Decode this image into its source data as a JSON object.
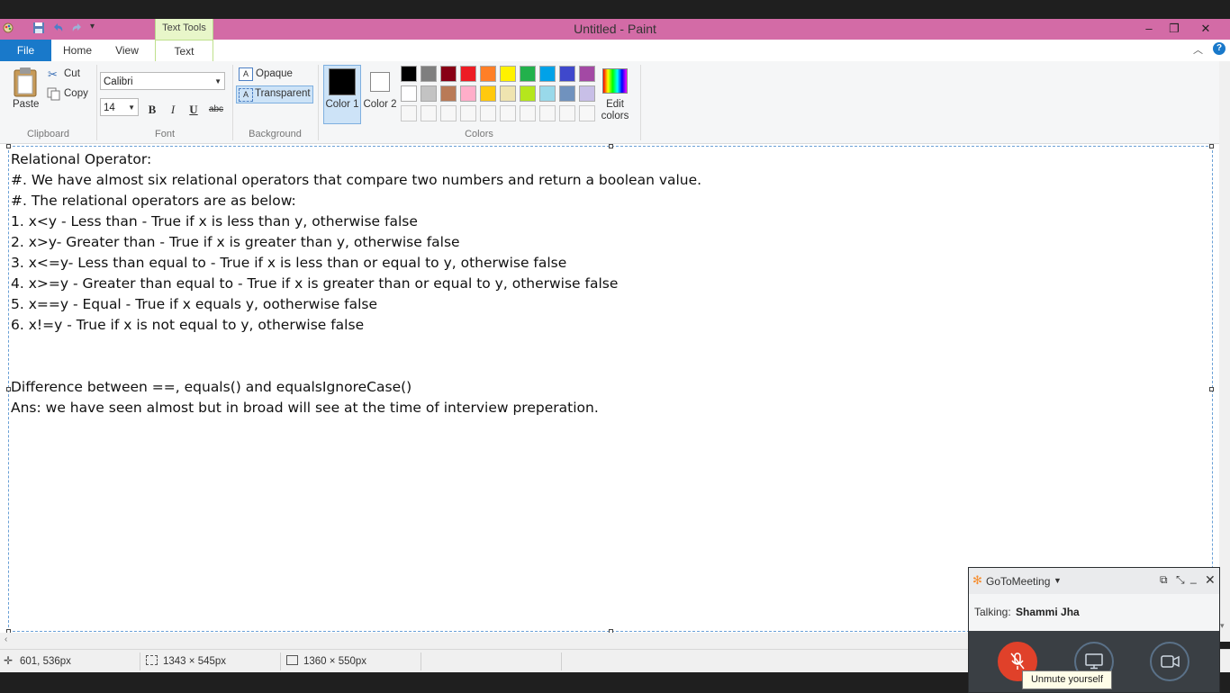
{
  "window": {
    "title": "Untitled - Paint",
    "contextual_tab": "Text Tools"
  },
  "tabs": [
    "File",
    "Home",
    "View",
    "Text"
  ],
  "ribbon": {
    "clipboard": {
      "label": "Clipboard",
      "paste": "Paste",
      "cut": "Cut",
      "copy": "Copy"
    },
    "font": {
      "label": "Font",
      "family": "Calibri",
      "size": "14",
      "bold": "B",
      "italic": "I",
      "underline": "U",
      "strike": "abc"
    },
    "background": {
      "label": "Background",
      "opaque": "Opaque",
      "transparent": "Transparent"
    },
    "colors": {
      "label": "Colors",
      "color1": "Color 1",
      "color2": "Color 2",
      "edit": "Edit colors",
      "color1_value": "#000000",
      "color2_value": "#ffffff",
      "row1": [
        "#000000",
        "#7f7f7f",
        "#880015",
        "#ed1c24",
        "#ff7f27",
        "#fff200",
        "#22b14c",
        "#00a2e8",
        "#3f48cc",
        "#a349a4"
      ],
      "row2": [
        "#ffffff",
        "#c3c3c3",
        "#b97a57",
        "#ffaec9",
        "#ffc90e",
        "#efe4b0",
        "#b5e61d",
        "#99d9ea",
        "#7092be",
        "#c8bfe7"
      ]
    }
  },
  "canvas": {
    "lines": [
      "Relational Operator:",
      "#. We have almost six relational operators that compare two numbers and return a boolean value.",
      "#. The relational operators are as below:",
      "1. x<y - Less than - True if x is less than y, otherwise false",
      "2. x>y- Greater than - True if x is greater than y, otherwise false",
      "3. x<=y- Less than equal to - True if x is less than or equal to y, otherwise false",
      "4. x>=y - Greater than equal to - True if x is greater than or equal to y, otherwise false",
      "5. x==y - Equal - True if x equals y, ootherwise false",
      "6. x!=y - True if x is not equal to y, otherwise false",
      "",
      "",
      "Difference between ==, equals() and equalsIgnoreCase()",
      "Ans: we have seen almost but in broad will see at the time of interview preperation."
    ]
  },
  "status": {
    "cursor": "601, 536px",
    "selection": "1343 × 545px",
    "canvas_size": "1360 × 550px"
  },
  "gotomeeting": {
    "brand": "GoToMeeting",
    "talking_label": "Talking:",
    "talking_name": "Shammi Jha",
    "tooltip": "Unmute yourself"
  }
}
